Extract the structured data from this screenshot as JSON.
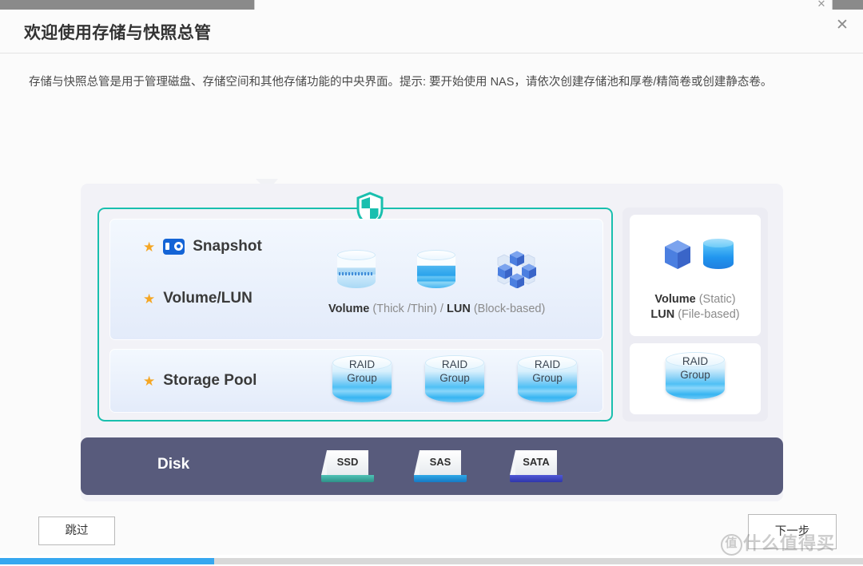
{
  "window": {
    "bg_tab_close_icon": "close-icon",
    "close_icon": "✕"
  },
  "dialog": {
    "title": "欢迎使用存储与快照总管",
    "description": "存储与快照总管是用于管理磁盘、存储空间和其他存储功能的中央界面。提示: 要开始使用 NAS，请依次创建存储池和厚卷/精简卷或创建静态卷。"
  },
  "diagram": {
    "shield_icon": "shield-icon",
    "rows": [
      {
        "star": "★",
        "icon": "camera-icon",
        "label": "Snapshot"
      },
      {
        "star": "★",
        "label": "Volume/LUN"
      },
      {
        "star": "★",
        "label": "Storage Pool"
      }
    ],
    "volume_caption": {
      "volume_bold": "Volume",
      "volume_rest": " (Thick /Thin)",
      "separator": " / ",
      "lun_bold": "LUN",
      "lun_rest": " (Block-based)"
    },
    "raid_groups": [
      {
        "line1": "RAID",
        "line2": "Group"
      },
      {
        "line1": "RAID",
        "line2": "Group"
      },
      {
        "line1": "RAID",
        "line2": "Group"
      }
    ],
    "right_column": {
      "static_caption": {
        "line1_bold": "Volume",
        "line1_rest": " (Static)",
        "line2_bold": "LUN",
        "line2_rest": " (File-based)"
      },
      "raid_group": {
        "line1": "RAID",
        "line2": "Group"
      }
    },
    "disk_section": {
      "label": "Disk",
      "disks": [
        {
          "name": "SSD",
          "color": "#3aa79e"
        },
        {
          "name": "SAS",
          "color": "#2196d8"
        },
        {
          "name": "SATA",
          "color": "#3f46c4"
        }
      ]
    }
  },
  "footer": {
    "skip_label": "跳过",
    "next_label": "下一步",
    "watermark_circle": "值",
    "watermark_text": "什么值得买"
  },
  "colors": {
    "teal_border": "#19bfae",
    "accent_blue": "#36a7ef",
    "disk_bar": "#585b7c",
    "star_gold": "#f5a623"
  }
}
